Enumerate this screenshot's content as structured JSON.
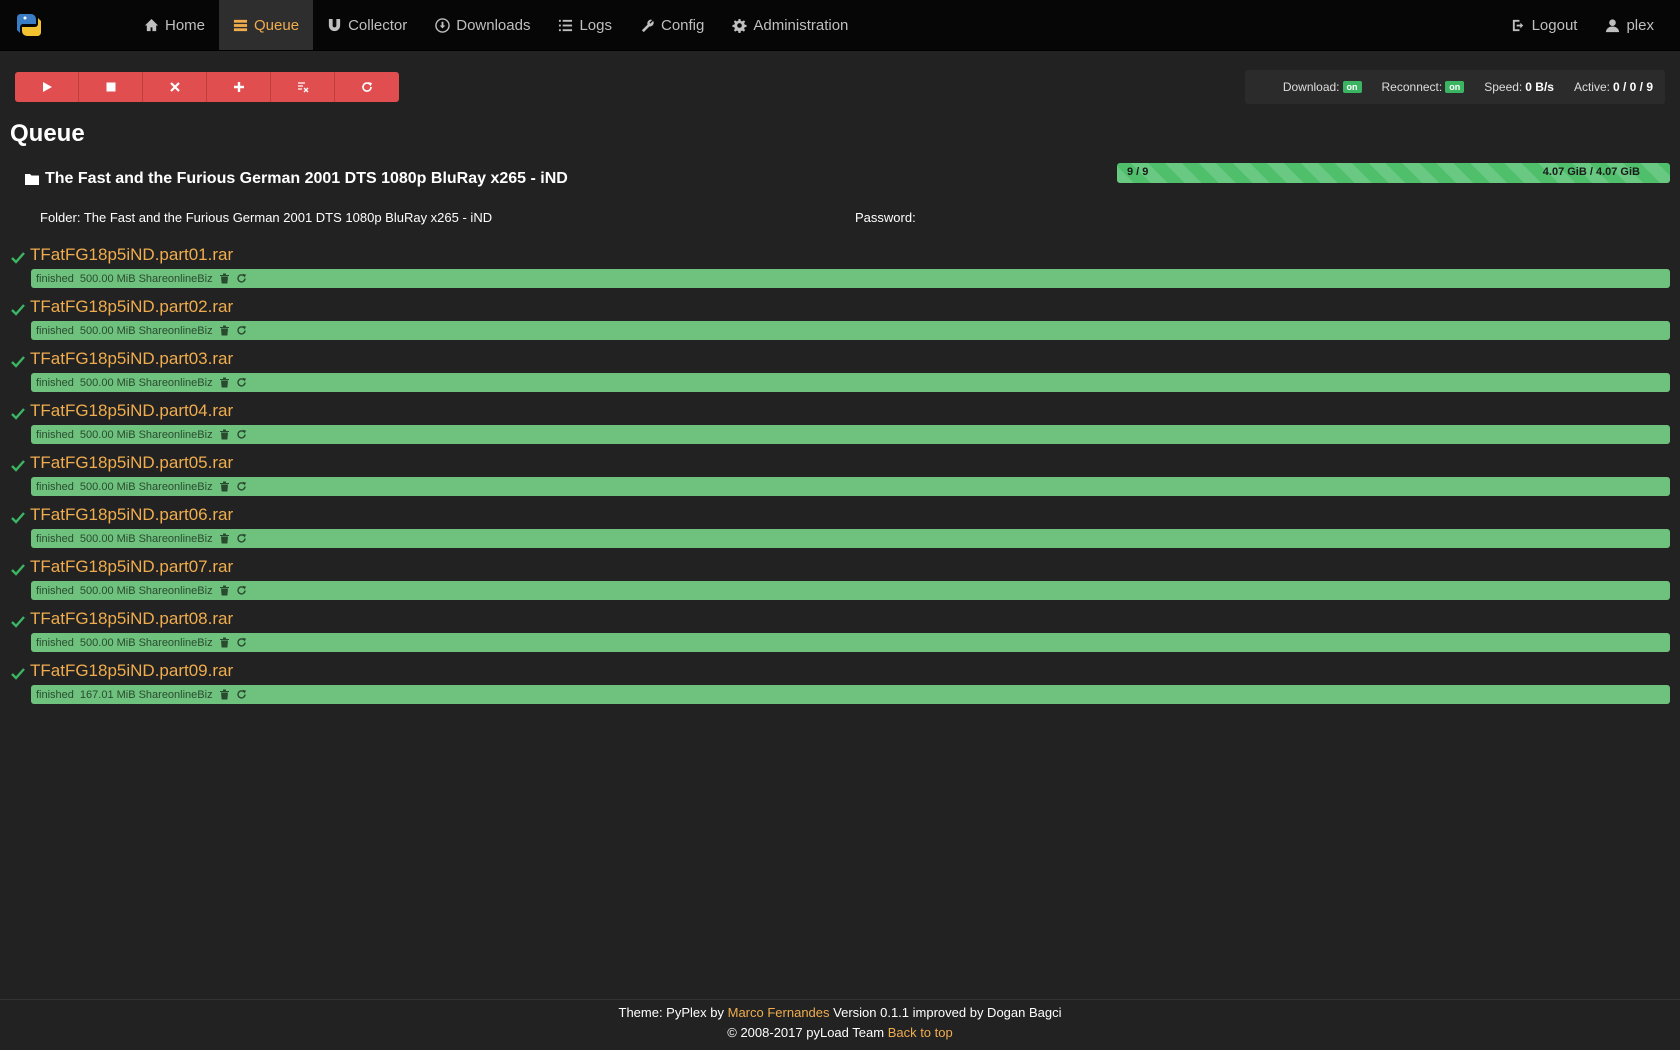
{
  "nav": {
    "items": [
      {
        "label": "Home",
        "icon": "home-icon"
      },
      {
        "label": "Queue",
        "icon": "list-icon"
      },
      {
        "label": "Collector",
        "icon": "magnet-icon"
      },
      {
        "label": "Downloads",
        "icon": "download-icon"
      },
      {
        "label": "Logs",
        "icon": "logs-icon"
      },
      {
        "label": "Config",
        "icon": "wrench-icon"
      },
      {
        "label": "Administration",
        "icon": "gear-icon"
      }
    ],
    "active": "Queue",
    "logout": "Logout",
    "user": "plex"
  },
  "toolbar": {
    "buttons": [
      "play-icon",
      "stop-icon",
      "cancel-icon",
      "add-icon",
      "clear-icon",
      "restart-icon"
    ]
  },
  "status": {
    "download_label": "Download:",
    "download_badge": "on",
    "reconnect_label": "Reconnect:",
    "reconnect_badge": "on",
    "speed_label": "Speed:",
    "speed_value": "0 B/s",
    "active_label": "Active:",
    "active_value": "0 / 0 / 9"
  },
  "page": {
    "title": "Queue"
  },
  "package": {
    "name": "The Fast and the Furious German 2001 DTS 1080p BluRay x265 - iND",
    "progress_count": "9 / 9",
    "progress_size": "4.07 GiB / 4.07 GiB",
    "progress_fraction": 1.0,
    "folder": "Folder: The Fast and the Furious German 2001 DTS 1080p BluRay x265 - iND",
    "password": "Password:"
  },
  "links": [
    {
      "name": "TFatFG18p5iND.part01.rar",
      "status": "finished",
      "size": "500.00 MiB",
      "host": "ShareonlineBiz"
    },
    {
      "name": "TFatFG18p5iND.part02.rar",
      "status": "finished",
      "size": "500.00 MiB",
      "host": "ShareonlineBiz"
    },
    {
      "name": "TFatFG18p5iND.part03.rar",
      "status": "finished",
      "size": "500.00 MiB",
      "host": "ShareonlineBiz"
    },
    {
      "name": "TFatFG18p5iND.part04.rar",
      "status": "finished",
      "size": "500.00 MiB",
      "host": "ShareonlineBiz"
    },
    {
      "name": "TFatFG18p5iND.part05.rar",
      "status": "finished",
      "size": "500.00 MiB",
      "host": "ShareonlineBiz"
    },
    {
      "name": "TFatFG18p5iND.part06.rar",
      "status": "finished",
      "size": "500.00 MiB",
      "host": "ShareonlineBiz"
    },
    {
      "name": "TFatFG18p5iND.part07.rar",
      "status": "finished",
      "size": "500.00 MiB",
      "host": "ShareonlineBiz"
    },
    {
      "name": "TFatFG18p5iND.part08.rar",
      "status": "finished",
      "size": "500.00 MiB",
      "host": "ShareonlineBiz"
    },
    {
      "name": "TFatFG18p5iND.part09.rar",
      "status": "finished",
      "size": "167.01 MiB",
      "host": "ShareonlineBiz"
    }
  ],
  "footer": {
    "theme_prefix": "Theme: PyPlex by",
    "author": "Marco Fernandes",
    "theme_suffix": "Version 0.1.1 improved by Dogan Bagci",
    "copyright": "© 2008-2017 pyLoad Team",
    "back_to_top": "Back to top"
  },
  "colors": {
    "accent": "#f0ad4e",
    "danger": "#e04e50",
    "success": "#6ec27d",
    "background": "#222222"
  }
}
